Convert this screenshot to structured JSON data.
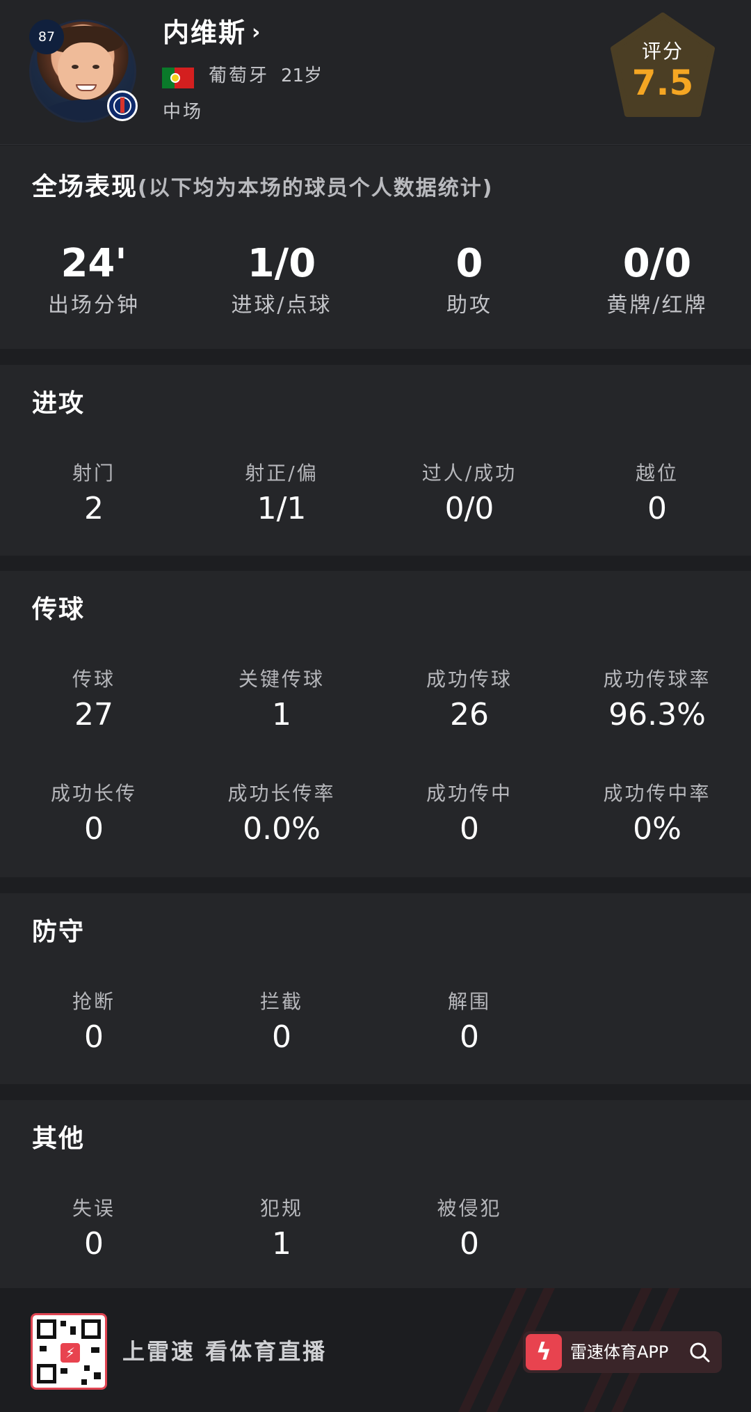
{
  "player": {
    "number": "87",
    "name": "内维斯",
    "nation": "葡萄牙",
    "age": "21岁",
    "position": "中场"
  },
  "rating": {
    "label": "评分",
    "value": "7.5"
  },
  "overview": {
    "title": "全场表现",
    "subtitle": "(以下均为本场的球员个人数据统计)",
    "stats": [
      {
        "value": "24'",
        "label": "出场分钟"
      },
      {
        "value": "1/0",
        "label": "进球/点球"
      },
      {
        "value": "0",
        "label": "助攻"
      },
      {
        "value": "0/0",
        "label": "黄牌/红牌"
      }
    ]
  },
  "attack": {
    "title": "进攻",
    "stats": [
      {
        "label": "射门",
        "value": "2"
      },
      {
        "label": "射正/偏",
        "value": "1/1"
      },
      {
        "label": "过人/成功",
        "value": "0/0"
      },
      {
        "label": "越位",
        "value": "0"
      }
    ]
  },
  "passing": {
    "title": "传球",
    "stats": [
      {
        "label": "传球",
        "value": "27"
      },
      {
        "label": "关键传球",
        "value": "1"
      },
      {
        "label": "成功传球",
        "value": "26"
      },
      {
        "label": "成功传球率",
        "value": "96.3%"
      },
      {
        "label": "成功长传",
        "value": "0"
      },
      {
        "label": "成功长传率",
        "value": "0.0%"
      },
      {
        "label": "成功传中",
        "value": "0"
      },
      {
        "label": "成功传中率",
        "value": "0%"
      }
    ]
  },
  "defense": {
    "title": "防守",
    "stats": [
      {
        "label": "抢断",
        "value": "0"
      },
      {
        "label": "拦截",
        "value": "0"
      },
      {
        "label": "解围",
        "value": "0"
      }
    ]
  },
  "other": {
    "title": "其他",
    "stats": [
      {
        "label": "失误",
        "value": "0"
      },
      {
        "label": "犯规",
        "value": "1"
      },
      {
        "label": "被侵犯",
        "value": "0"
      }
    ]
  },
  "footer": {
    "slogan": "上雷速 看体育直播",
    "app_label": "雷速体育APP"
  },
  "colors": {
    "accent": "#f5a623",
    "brand": "#e8434f"
  },
  "icons": [
    "chevron-right-icon",
    "flag-portugal-icon",
    "club-badge-icon",
    "qr-code-icon",
    "app-logo-icon",
    "search-icon"
  ]
}
